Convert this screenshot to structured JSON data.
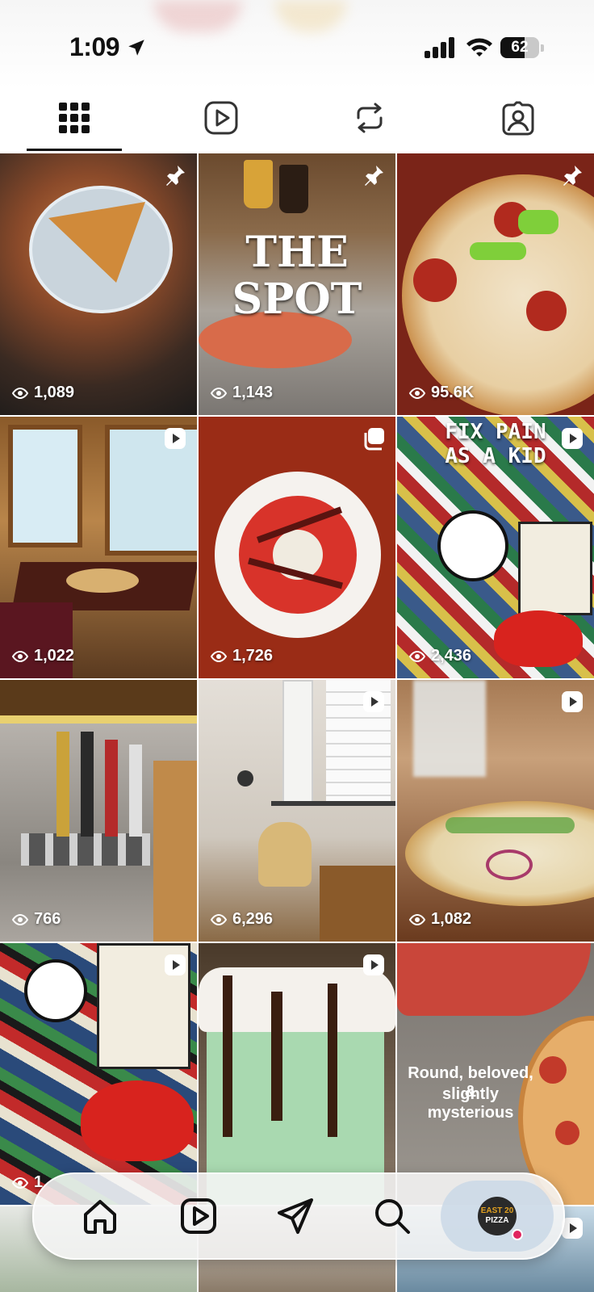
{
  "status": {
    "time": "1:09",
    "battery": "62",
    "battery_level": 0.62
  },
  "tabs": [
    {
      "name": "posts",
      "icon": "grid-icon",
      "active": true
    },
    {
      "name": "reels",
      "icon": "reels-icon",
      "active": false
    },
    {
      "name": "reposts",
      "icon": "repost-icon",
      "active": false
    },
    {
      "name": "tagged",
      "icon": "tagged-icon",
      "active": false
    }
  ],
  "posts": [
    {
      "views": "1,089",
      "badge": "pin-icon"
    },
    {
      "views": "1,143",
      "badge": "pin-icon",
      "overlay_lines": [
        "THE",
        "SPOT"
      ]
    },
    {
      "views": "95.6K",
      "badge": "pin-icon"
    },
    {
      "views": "1,022",
      "badge": "reel-icon"
    },
    {
      "views": "1,726",
      "badge": "carousel-icon"
    },
    {
      "views": "2,436",
      "badge": "reel-icon",
      "overlay_lines": [
        "FIX PAIN",
        "AS A KID"
      ]
    },
    {
      "views": "766",
      "badge": ""
    },
    {
      "views": "6,296",
      "badge": "reel-icon"
    },
    {
      "views": "1,082",
      "badge": "reel-icon"
    },
    {
      "views": "1",
      "badge": "reel-icon"
    },
    {
      "views": "",
      "badge": "reel-icon"
    },
    {
      "views": "",
      "badge": "",
      "caption_lines": [
        "Round, beloved, &",
        "slightly mysterious"
      ]
    },
    {
      "views": "",
      "badge": ""
    },
    {
      "views": "",
      "badge": ""
    },
    {
      "views": "",
      "badge": "reel-icon"
    }
  ],
  "nav": {
    "items": [
      "home-icon",
      "reels-icon",
      "messages-icon",
      "search-icon"
    ],
    "profile_text_line1": "EAST 20",
    "profile_text_line2": "PIZZA"
  },
  "colors": {
    "accent": "#111111",
    "notification": "#e0245e"
  }
}
